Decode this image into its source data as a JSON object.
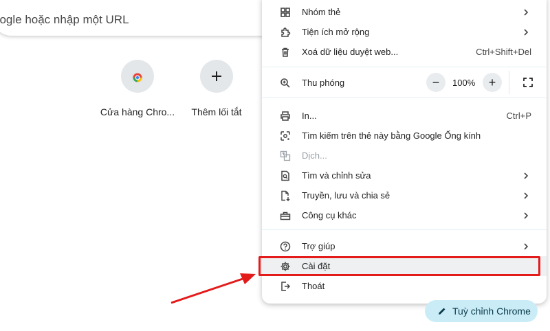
{
  "omnibox": {
    "placeholder_text": "oogle hoặc nhập một URL"
  },
  "shortcuts": [
    {
      "label": "Cửa hàng Chro...",
      "icon": "chrome-web-store-icon"
    },
    {
      "label": "Thêm lối tắt",
      "icon": "plus-icon"
    }
  ],
  "menu": {
    "items": [
      {
        "label": "Nhóm thẻ",
        "icon": "tab-groups-icon",
        "has_submenu": true
      },
      {
        "label": "Tiện ích mở rộng",
        "icon": "extensions-icon",
        "has_submenu": true
      },
      {
        "label": "Xoá dữ liệu duyệt web...",
        "icon": "trash-icon",
        "shortcut": "Ctrl+Shift+Del"
      },
      {
        "label": "Thu phóng",
        "icon": "zoom-icon"
      },
      {
        "label": "In...",
        "icon": "print-icon",
        "shortcut": "Ctrl+P"
      },
      {
        "label": "Tìm kiếm trên thẻ này bằng Google Ống kính",
        "icon": "google-lens-icon"
      },
      {
        "label": "Dịch...",
        "icon": "translate-icon",
        "disabled": true
      },
      {
        "label": "Tìm và chỉnh sửa",
        "icon": "find-edit-icon",
        "has_submenu": true
      },
      {
        "label": "Truyền, lưu và chia sẻ",
        "icon": "cast-save-share-icon",
        "has_submenu": true
      },
      {
        "label": "Công cụ khác",
        "icon": "toolbox-icon",
        "has_submenu": true
      },
      {
        "label": "Trợ giúp",
        "icon": "help-icon",
        "has_submenu": true
      },
      {
        "label": "Cài đặt",
        "icon": "gear-icon",
        "highlighted": true
      },
      {
        "label": "Thoát",
        "icon": "exit-icon"
      }
    ],
    "zoom": {
      "minus": "−",
      "value": "100%",
      "plus": "+"
    }
  },
  "customize_chrome": {
    "label": "Tuỳ chỉnh Chrome",
    "icon": "pencil-icon"
  },
  "colors": {
    "highlight_box": "#e31b1b",
    "arrow": "#e31b1b",
    "customize_bg": "#c9ecf7",
    "menu_separator": "#e3f0f3"
  }
}
